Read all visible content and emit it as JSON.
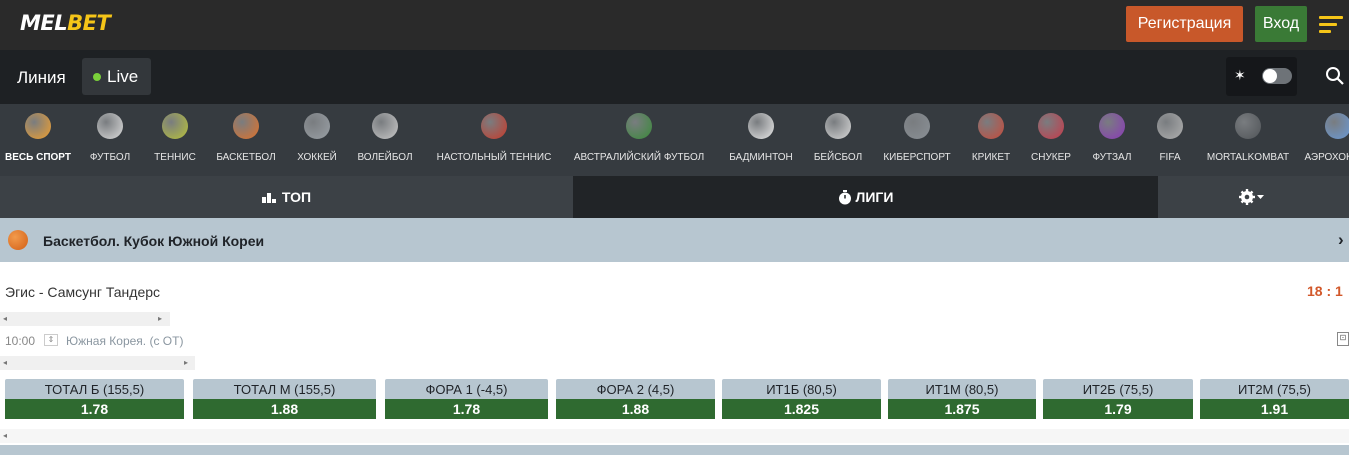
{
  "header": {
    "logo_mel": "MEL",
    "logo_bet": "BET",
    "register_label": "Регистрация",
    "login_label": "Вход"
  },
  "nav": {
    "line_label": "Линия",
    "live_label": "Live"
  },
  "sports": [
    {
      "label": "Весь спорт",
      "icon": "all-sports-icon",
      "color": "#f0a030"
    },
    {
      "label": "Футбол",
      "icon": "football-icon",
      "color": "#dcdcdc"
    },
    {
      "label": "Теннис",
      "icon": "tennis-icon",
      "color": "#b8c23a"
    },
    {
      "label": "Баскетбол",
      "icon": "basketball-icon",
      "color": "#e0722a"
    },
    {
      "label": "Хоккей",
      "icon": "hockey-icon",
      "color": "#9aa0a6"
    },
    {
      "label": "Волейбол",
      "icon": "volleyball-icon",
      "color": "#c8c8c8"
    },
    {
      "label": "Настольный теннис",
      "icon": "table-tennis-icon",
      "color": "#c83a2a"
    },
    {
      "label": "Австралийский футбол",
      "icon": "aussie-football-icon",
      "color": "#3a8a3a"
    },
    {
      "label": "Бадминтон",
      "icon": "badminton-icon",
      "color": "#e8e8e8"
    },
    {
      "label": "Бейсбол",
      "icon": "baseball-icon",
      "color": "#d8d8d8"
    },
    {
      "label": "Киберспорт",
      "icon": "esports-icon",
      "color": "#8a9096"
    },
    {
      "label": "Крикет",
      "icon": "cricket-icon",
      "color": "#c84a3a"
    },
    {
      "label": "Снукер",
      "icon": "snooker-icon",
      "color": "#c83a4a"
    },
    {
      "label": "Футзал",
      "icon": "futsal-icon",
      "color": "#8a3ab8"
    },
    {
      "label": "FIFA",
      "icon": "fifa-icon",
      "color": "#b0b0b0"
    },
    {
      "label": "MortalKombat",
      "icon": "mortalkombat-icon",
      "color": "#505458"
    },
    {
      "label": "Аэрохоккей",
      "icon": "air-hockey-icon",
      "color": "#6a9ad8"
    }
  ],
  "tabs": {
    "top_label": "ТОП",
    "leagues_label": "ЛИГИ"
  },
  "league": {
    "name": "Баскетбол. Кубок Южной Кореи"
  },
  "match": {
    "teams": "Эгис - Самсунг Тандерс",
    "score": "18 : 1",
    "time": "10:00",
    "country": "Южная Корея. (с ОТ)"
  },
  "odds": [
    {
      "label": "ТОТАЛ Б (155,5)",
      "value": "1.78"
    },
    {
      "label": "ТОТАЛ М (155,5)",
      "value": "1.88"
    },
    {
      "label": "ФОРА 1 (-4,5)",
      "value": "1.78"
    },
    {
      "label": "ФОРА 2 (4,5)",
      "value": "1.88"
    },
    {
      "label": "ИТ1Б (80,5)",
      "value": "1.825"
    },
    {
      "label": "ИТ1М (80,5)",
      "value": "1.875"
    },
    {
      "label": "ИТ2Б (75,5)",
      "value": "1.79"
    },
    {
      "label": "ИТ2М (75,5)",
      "value": "1.91"
    }
  ],
  "colors": {
    "register": "#c8582a",
    "login": "#3a7a36",
    "odd_value_bg": "#2f6a30",
    "league_bg": "#b7c6d0",
    "score": "#d2582a"
  }
}
